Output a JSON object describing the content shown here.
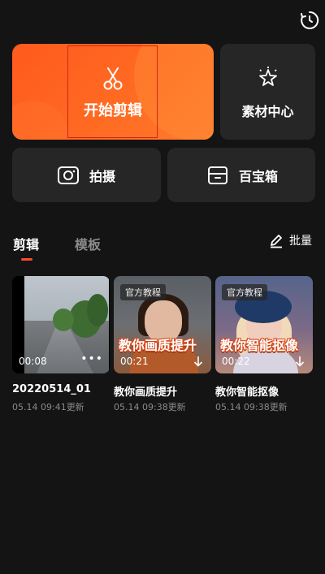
{
  "header": {
    "history_icon": "clock-refresh-icon"
  },
  "actions": {
    "start_edit": {
      "label": "开始剪辑",
      "icon": "scissors-icon"
    },
    "materials": {
      "label": "素材中心",
      "icon": "sparkle-icon"
    },
    "shoot": {
      "label": "拍摄",
      "icon": "camera-icon"
    },
    "toolbox": {
      "label": "百宝箱",
      "icon": "toolbox-icon"
    }
  },
  "tabs": [
    {
      "label": "剪辑",
      "active": true
    },
    {
      "label": "模板",
      "active": false
    }
  ],
  "batch": {
    "label": "批量",
    "icon": "edit-pencil-icon"
  },
  "projects": [
    {
      "title": "20220514_01",
      "updated": "05.14 09:41更新",
      "duration": "00:08",
      "badge": "",
      "caption": "",
      "more": "•••"
    },
    {
      "title": "教你画质提升",
      "updated": "05.14 09:38更新",
      "duration": "00:21",
      "badge": "官方教程",
      "caption": "教你画质提升",
      "more": ""
    },
    {
      "title": "教你智能抠像",
      "updated": "05.14 09:38更新",
      "duration": "00:22",
      "badge": "官方教程",
      "caption": "教你智能抠像",
      "more": ""
    }
  ],
  "colors": {
    "accent": "#ff4a2a",
    "card": "#262626",
    "background": "#141414"
  }
}
